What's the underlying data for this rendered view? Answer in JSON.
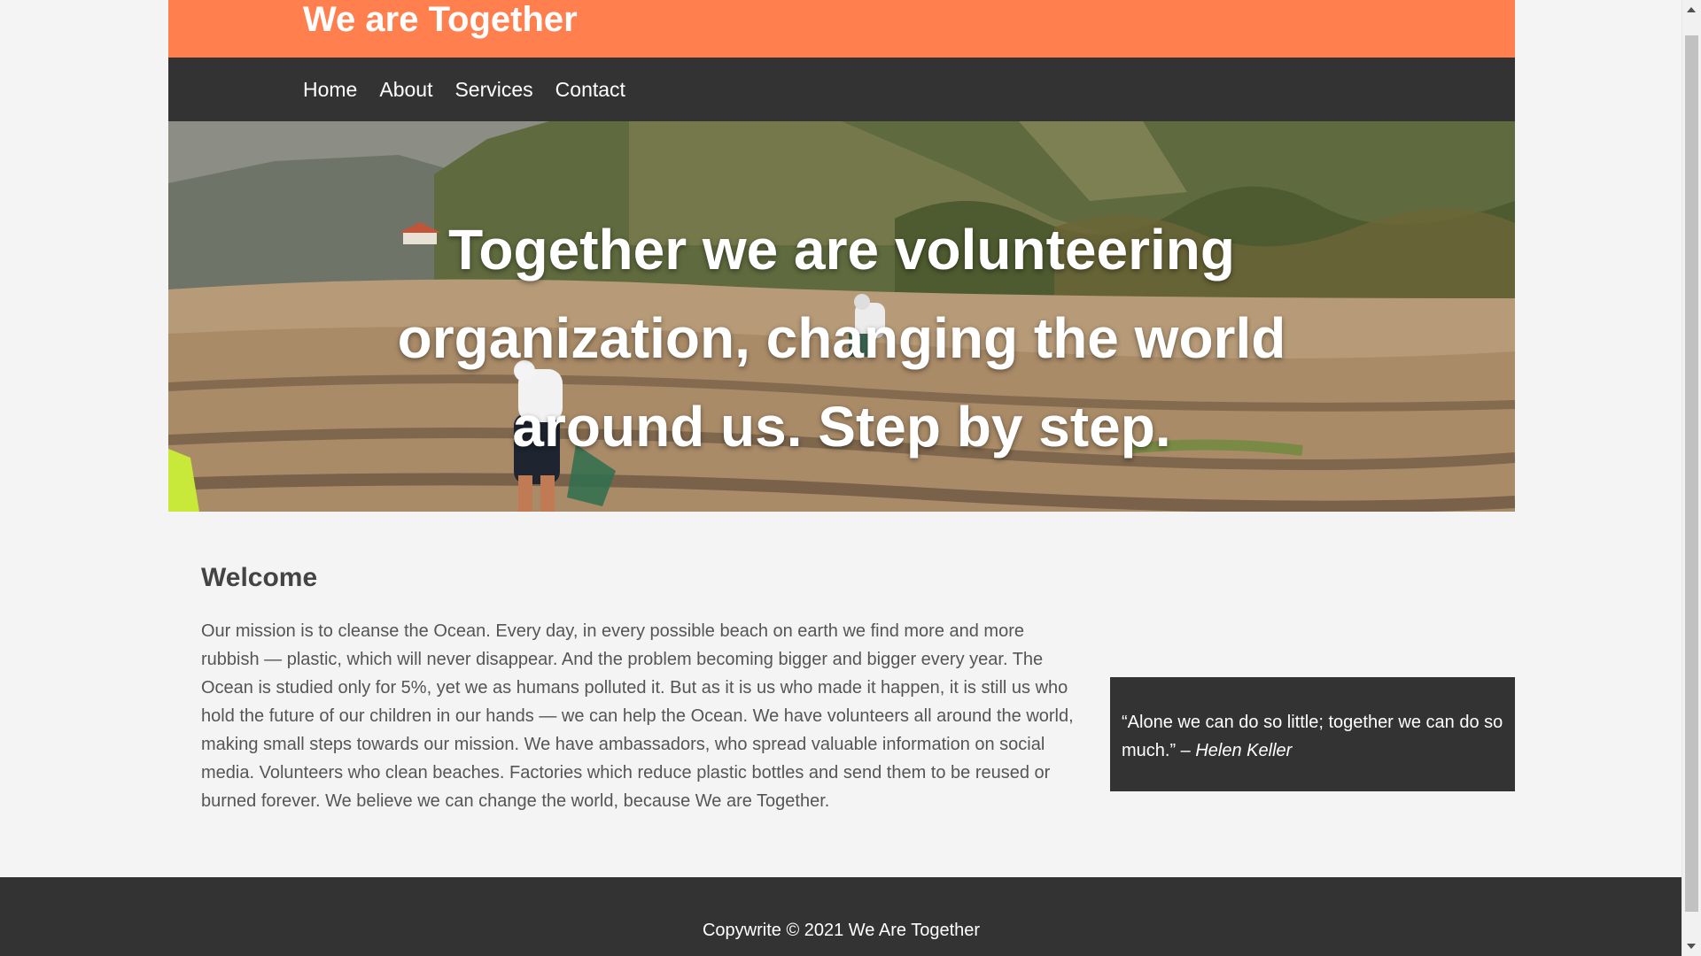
{
  "header": {
    "site_title": "We are Together",
    "background_color": "#ff7f4e"
  },
  "nav": {
    "items": [
      {
        "label": "Home"
      },
      {
        "label": "About"
      },
      {
        "label": "Services"
      },
      {
        "label": "Contact"
      }
    ],
    "background_color": "#333333"
  },
  "hero": {
    "headline": "Together we are volunteering organization, changing the world around us. Step by step.",
    "image_description_icon": "beach-cleanup-photo"
  },
  "welcome": {
    "title": "Welcome",
    "text": "Our mission is to cleanse the Ocean. Every day, in every possible beach on earth we find more and more rubbish — plastic, which will never disappear. And the problem becoming bigger and bigger every year. The Ocean is studied only for 5%, yet we as humans polluted it. But as it is us who made it happen, it is still us who hold the future of our children in our hands — we can help the Ocean. We have volunteers all around the world, making small steps towards our mission. We have ambassadors, who spread valuable information on social media. Volunteers who clean beaches. Factories which reduce plastic bottles and send them to be reused or burned forever. We believe we can change the world, because We are Together."
  },
  "quote": {
    "text": "“Alone we can do so little; together we can do so much.” – ",
    "author": "Helen Keller"
  },
  "footer": {
    "copyright": "Copywrite © 2021 We Are Together"
  }
}
